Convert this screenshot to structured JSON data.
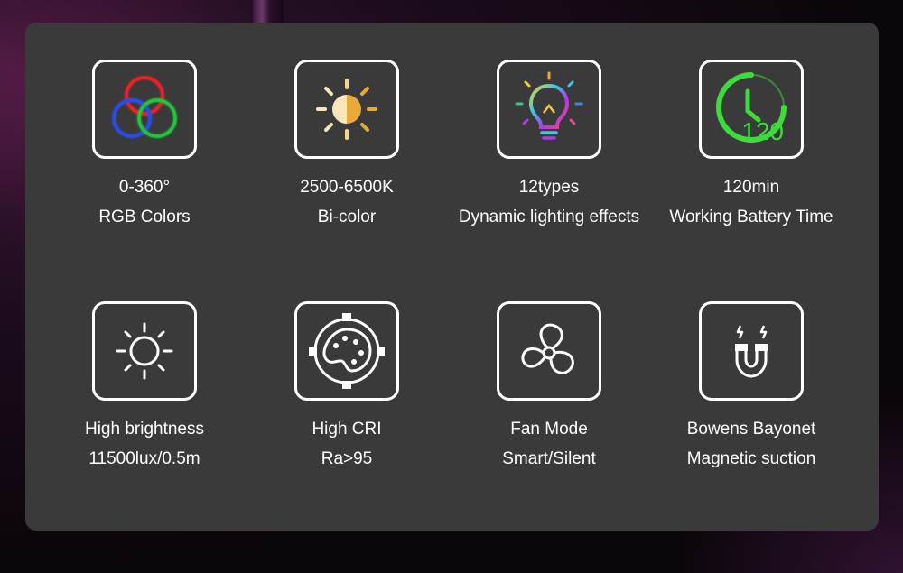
{
  "features": [
    {
      "name": "rgb",
      "icon": "rgb-circles-icon",
      "line1": "0-360°",
      "line2": "RGB Colors"
    },
    {
      "name": "bicolor",
      "icon": "bicolor-sun-icon",
      "line1": "2500-6500K",
      "line2": "Bi-color"
    },
    {
      "name": "effects",
      "icon": "rainbow-bulb-icon",
      "line1": "12types",
      "line2": "Dynamic lighting effects"
    },
    {
      "name": "battery",
      "icon": "battery-timer-icon",
      "icon_text": "120",
      "line1": "120min",
      "line2": "Working Battery Time"
    },
    {
      "name": "brightness",
      "icon": "sun-icon",
      "line1": "High brightness",
      "line2": "11500lux/0.5m"
    },
    {
      "name": "cri",
      "icon": "palette-icon",
      "line1": "High CRI",
      "line2": "Ra>95"
    },
    {
      "name": "fan",
      "icon": "fan-icon",
      "line1": "Fan Mode",
      "line2": "Smart/Silent"
    },
    {
      "name": "mount",
      "icon": "magnet-icon",
      "line1": "Bowens Bayonet",
      "line2": "Magnetic suction"
    }
  ],
  "colors": {
    "panel": "#3a3a3a",
    "text": "#ffffff",
    "rgb_red": "#e8202a",
    "rgb_green": "#22c43a",
    "rgb_blue": "#2a4de8",
    "timer_green": "#3ddc3a",
    "warm_yellow": "#f2c14e"
  }
}
